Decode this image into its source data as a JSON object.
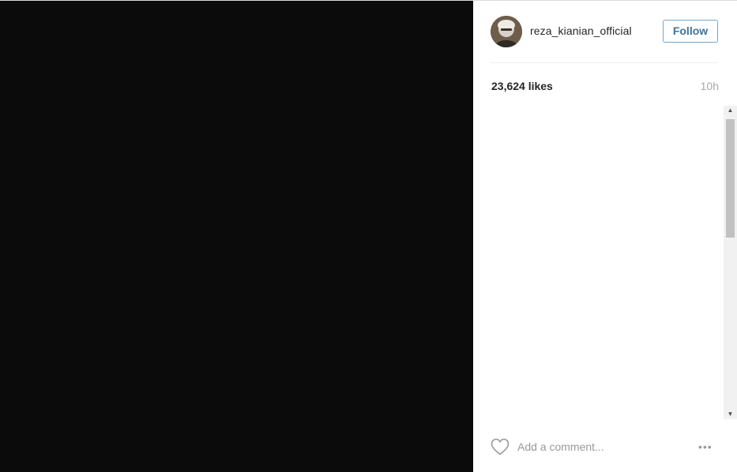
{
  "post": {
    "username": "reza_kianian_official",
    "follow_label": "Follow",
    "likes_text": "23,624 likes",
    "time_ago": "10h"
  },
  "comment_bar": {
    "placeholder": "Add a comment...",
    "more_glyph": "•••"
  },
  "colors": {
    "media_background": "#0b0b0b",
    "follow_accent": "#3f729b",
    "text_primary": "#262626",
    "text_muted": "#999999"
  },
  "icons": {
    "like": "heart-outline-icon",
    "more": "more-options-icon"
  }
}
